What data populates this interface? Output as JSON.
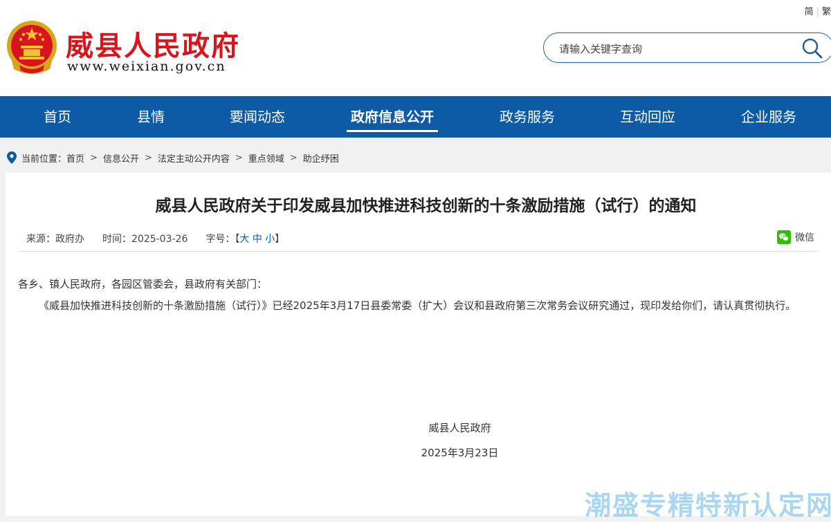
{
  "header": {
    "lang_simplified": "简",
    "lang_traditional": "繁",
    "site_title": "威县人民政府",
    "site_domain": "www.weixian.gov.cn",
    "search_placeholder": "请输入关键字查询"
  },
  "nav": {
    "items": [
      {
        "label": "首页"
      },
      {
        "label": "县情"
      },
      {
        "label": "要闻动态"
      },
      {
        "label": "政府信息公开"
      },
      {
        "label": "政务服务"
      },
      {
        "label": "互动回应"
      },
      {
        "label": "企业服务"
      }
    ],
    "active_index": 3
  },
  "breadcrumb": {
    "prefix": "当前位置：",
    "items": [
      "首页",
      "信息公开",
      "法定主动公开内容",
      "重点领域",
      "助企纾困"
    ],
    "separator": ">"
  },
  "article": {
    "title": "威县人民政府关于印发威县加快推进科技创新的十条激励措施（试行）的通知",
    "source": "来源：政府办",
    "time": "时间：2025-03-26",
    "size_label": "字号：",
    "size_open": "【",
    "size_large": "大",
    "size_medium": "中",
    "size_small": "小",
    "size_close": "】",
    "wechat_label": "微信",
    "salutation": "各乡、镇人民政府，各园区管委会，县政府有关部门：",
    "paragraph": "《威县加快推进科技创新的十条激励措施（试行）》已经2025年3月17日县委常委（扩大）会议和县政府第三次常务会议研究通过，现印发给你们，请认真贯彻执行。",
    "signature": "威县人民政府",
    "date": "2025年3月23日"
  },
  "watermark": "潮盛专精特新认定网",
  "colors": {
    "nav_bg": "#0d5aa7",
    "title_red": "#d8141c",
    "wechat_green": "#2dc100"
  }
}
